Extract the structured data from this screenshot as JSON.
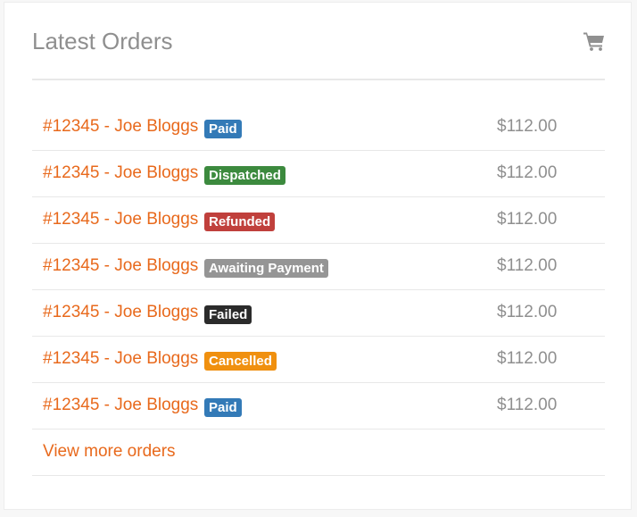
{
  "panel": {
    "title": "Latest Orders",
    "header_icon": "shopping-cart-icon"
  },
  "orders": [
    {
      "label": "#12345 - Joe Bloggs",
      "status": "Paid",
      "status_color": "#337ab7",
      "amount": "$112.00"
    },
    {
      "label": "#12345 - Joe Bloggs",
      "status": "Dispatched",
      "status_color": "#3c8a3e",
      "amount": "$112.00"
    },
    {
      "label": "#12345 - Joe Bloggs",
      "status": "Refunded",
      "status_color": "#c0403c",
      "amount": "$112.00"
    },
    {
      "label": "#12345 - Joe Bloggs",
      "status": "Awaiting Payment",
      "status_color": "#959595",
      "amount": "$112.00"
    },
    {
      "label": "#12345 - Joe Bloggs",
      "status": "Failed",
      "status_color": "#2b2b2b",
      "amount": "$112.00"
    },
    {
      "label": "#12345 - Joe Bloggs",
      "status": "Cancelled",
      "status_color": "#f0900f",
      "amount": "$112.00"
    },
    {
      "label": "#12345 - Joe Bloggs",
      "status": "Paid",
      "status_color": "#337ab7",
      "amount": "$112.00"
    }
  ],
  "footer": {
    "view_more_label": "View more orders"
  },
  "colors": {
    "link": "#e8691c",
    "muted_text": "#8f8f8f",
    "divider": "#e8e8e8",
    "icon": "#909090"
  }
}
